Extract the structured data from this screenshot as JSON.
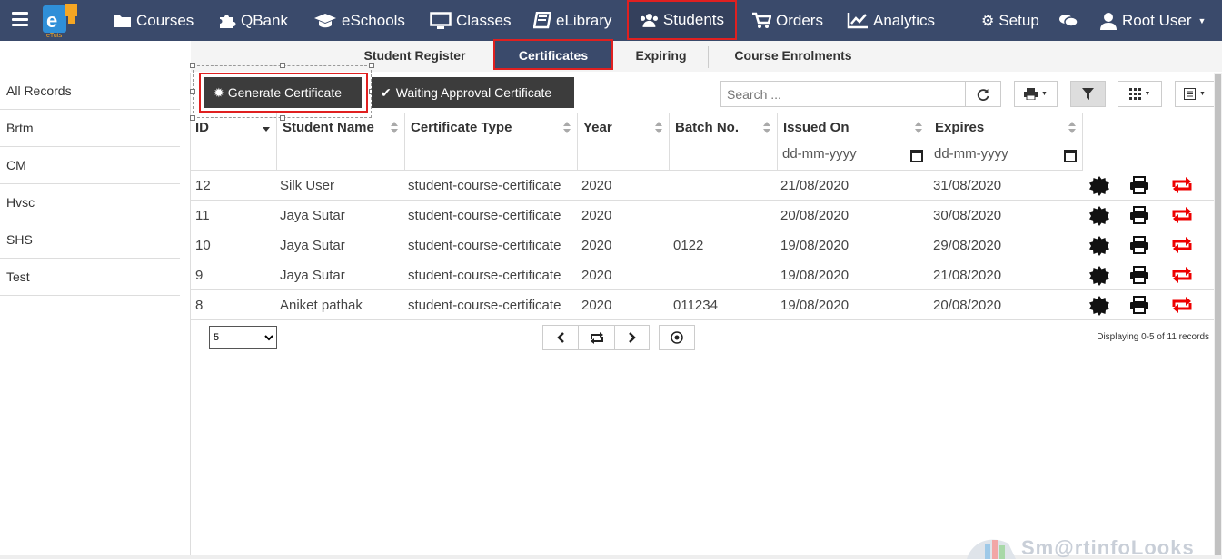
{
  "nav": {
    "items": [
      {
        "label": "Courses",
        "icon": "folder-icon"
      },
      {
        "label": "QBank",
        "icon": "puzzle-icon"
      },
      {
        "label": "eSchools",
        "icon": "graduation-cap-icon"
      },
      {
        "label": "Classes",
        "icon": "monitor-icon"
      },
      {
        "label": "eLibrary",
        "icon": "book-icon"
      },
      {
        "label": "Students",
        "icon": "users-icon",
        "active": true
      },
      {
        "label": "Orders",
        "icon": "cart-icon"
      },
      {
        "label": "Analytics",
        "icon": "line-chart-icon"
      }
    ],
    "setup_label": "Setup",
    "user_label": "Root User",
    "logo_text": "eTuts"
  },
  "subnav": {
    "tabs": [
      "Student Register",
      "Certificates",
      "Expiring",
      "Course Enrolments"
    ],
    "active": "Certificates"
  },
  "sidebar": {
    "items": [
      "All Records",
      "Brtm",
      "CM",
      "Hvsc",
      "SHS",
      "Test"
    ]
  },
  "toolbar": {
    "generate_label": "Generate Certificate",
    "waiting_label": "Waiting Approval Certificate",
    "search_placeholder": "Search ..."
  },
  "table": {
    "columns": [
      "ID",
      "Student Name",
      "Certificate Type",
      "Year",
      "Batch No.",
      "Issued On",
      "Expires"
    ],
    "date_placeholder": "dd-mm-yyyy",
    "rows": [
      {
        "id": "12",
        "name": "Silk User",
        "type": "student-course-certificate",
        "year": "2020",
        "batch": "",
        "issued": "21/08/2020",
        "expires": "31/08/2020"
      },
      {
        "id": "11",
        "name": "Jaya Sutar",
        "type": "student-course-certificate",
        "year": "2020",
        "batch": "",
        "issued": "20/08/2020",
        "expires": "30/08/2020"
      },
      {
        "id": "10",
        "name": "Jaya Sutar",
        "type": "student-course-certificate",
        "year": "2020",
        "batch": "0122",
        "issued": "19/08/2020",
        "expires": "29/08/2020"
      },
      {
        "id": "9",
        "name": "Jaya Sutar",
        "type": "student-course-certificate",
        "year": "2020",
        "batch": "",
        "issued": "19/08/2020",
        "expires": "21/08/2020"
      },
      {
        "id": "8",
        "name": "Aniket pathak",
        "type": "student-course-certificate",
        "year": "2020",
        "batch": "011234",
        "issued": "19/08/2020",
        "expires": "20/08/2020"
      }
    ]
  },
  "pager": {
    "page_size": "5",
    "display_text": "Displaying 0-5 of 11 records"
  },
  "watermark": "Sm@rtinfoLooks",
  "colors": {
    "nav_bg": "#3a4a6b",
    "highlight": "#e02020",
    "dark_button": "#3c3c3c"
  }
}
